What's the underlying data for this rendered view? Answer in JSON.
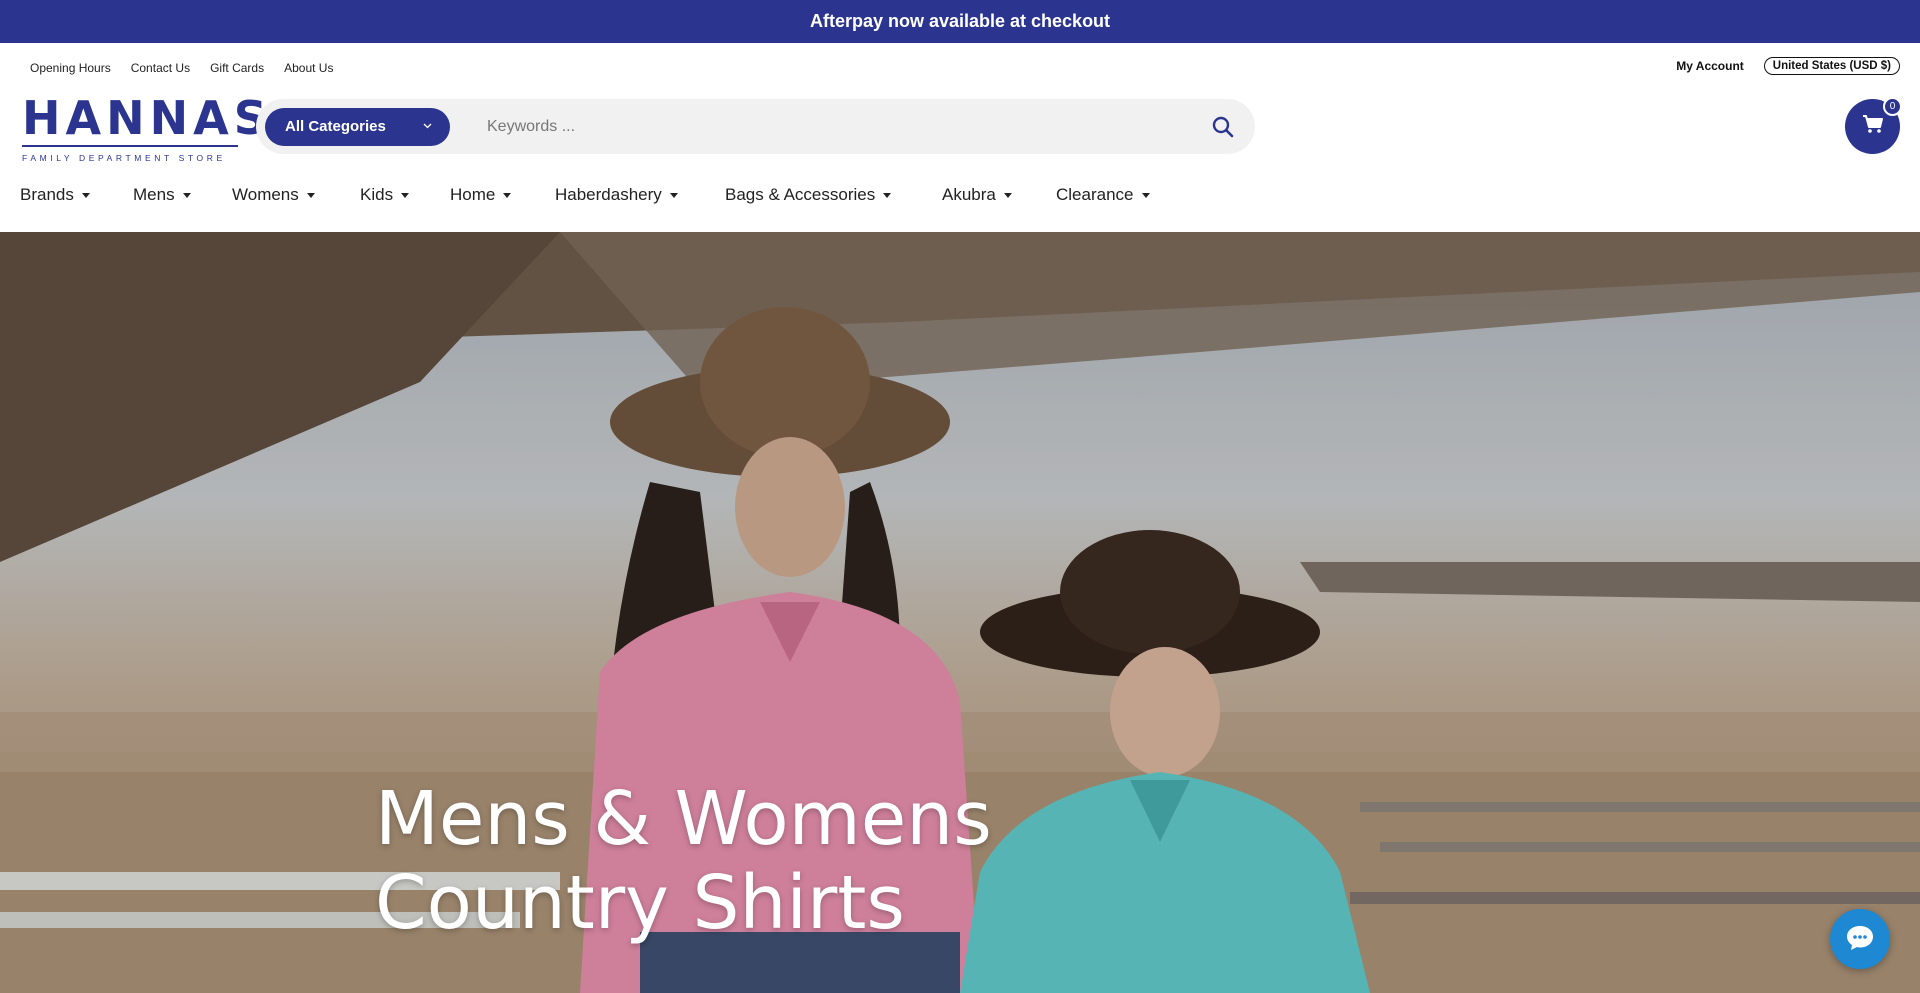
{
  "announcement": "Afterpay now available at checkout",
  "utility_links": [
    "Opening Hours",
    "Contact Us",
    "Gift Cards",
    "About Us"
  ],
  "account": {
    "my_account": "My Account",
    "currency": "United States (USD $)"
  },
  "logo": {
    "name": "HANNAS",
    "tagline": "FAMILY DEPARTMENT STORE"
  },
  "search": {
    "category_label": "All Categories",
    "placeholder": "Keywords ..."
  },
  "cart": {
    "count": "0"
  },
  "nav": [
    "Brands",
    "Mens",
    "Womens",
    "Kids",
    "Home",
    "Haberdashery",
    "Bags & Accessories",
    "Akubra",
    "Clearance"
  ],
  "hero": {
    "line1": "Mens & Womens",
    "line2": "Country Shirts"
  },
  "colors": {
    "brand": "#2b3590",
    "chat": "#1e88d3"
  }
}
